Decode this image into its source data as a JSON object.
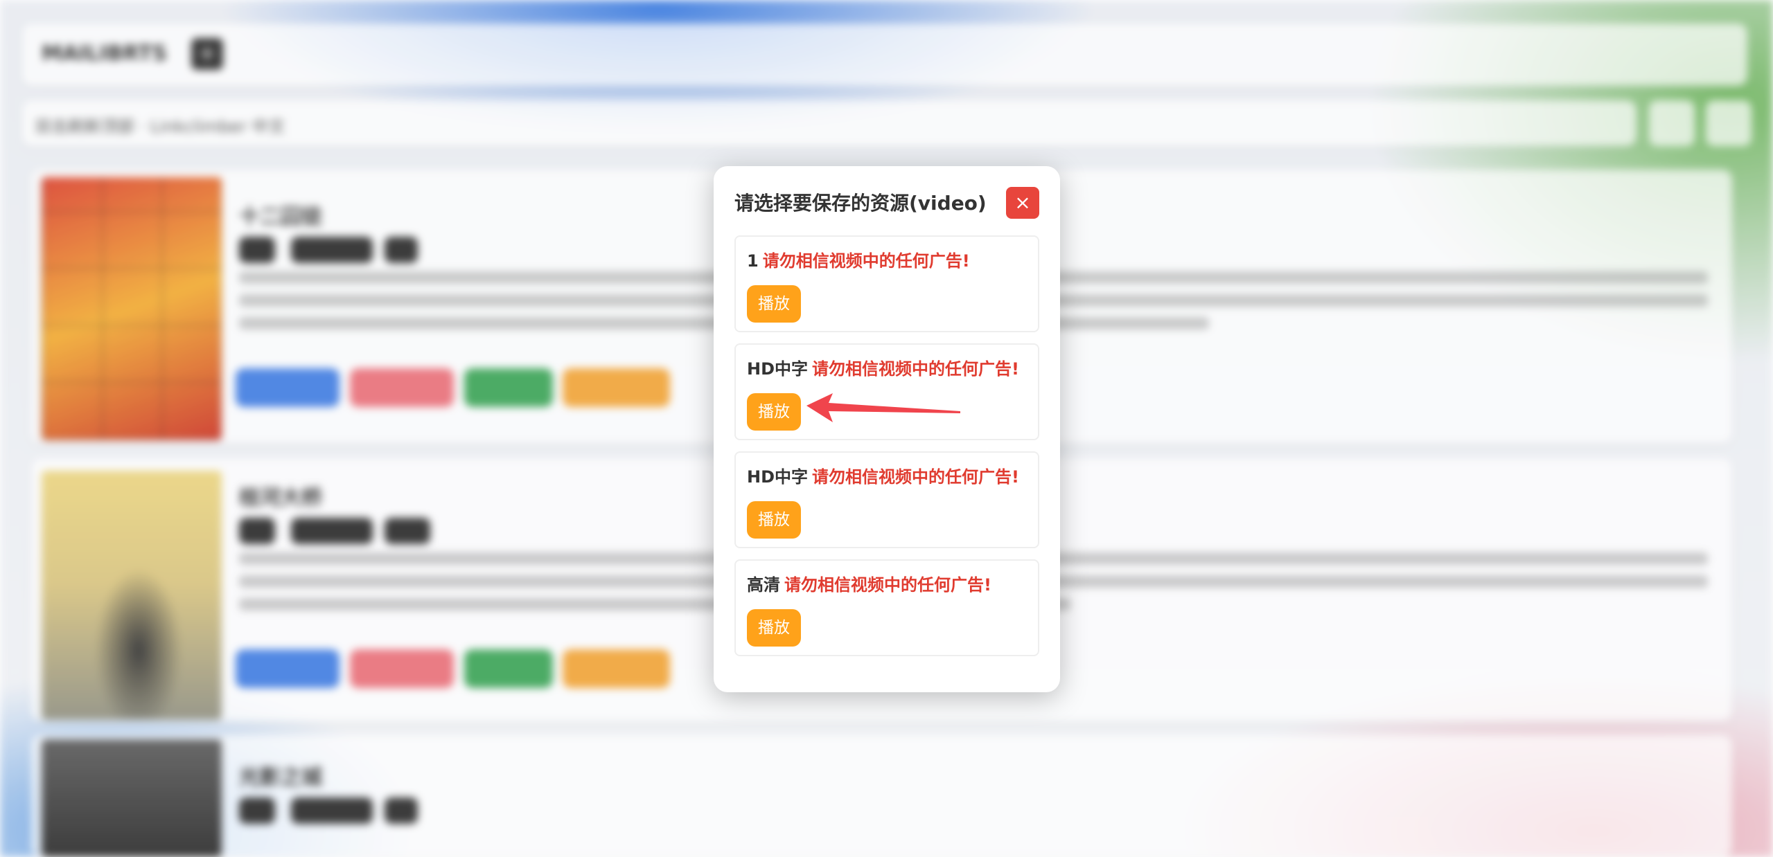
{
  "background": {
    "brand": "MAILIBRTS",
    "nav_text": "双击刷新顶部 · Linkclimber 中文",
    "movies": [
      {
        "title": "十二囚徒"
      },
      {
        "title": "桂河大桥"
      },
      {
        "title": "光影之城"
      }
    ]
  },
  "modal": {
    "title": "请选择要保存的资源(video)",
    "close_label": "×",
    "resources": [
      {
        "name": "1",
        "warning": "请勿相信视频中的任何广告!",
        "play_label": "播放"
      },
      {
        "name": "HD中字",
        "warning": "请勿相信视频中的任何广告!",
        "play_label": "播放"
      },
      {
        "name": "HD中字",
        "warning": "请勿相信视频中的任何广告!",
        "play_label": "播放"
      },
      {
        "name": "高清",
        "warning": "请勿相信视频中的任何广告!",
        "play_label": "播放"
      }
    ]
  },
  "colors": {
    "play_button": "#ffa21a",
    "close_button": "#e8453c",
    "warning_text": "#e03b2f",
    "annotation_arrow": "#f0444c"
  },
  "icons": {
    "close": "close-icon",
    "annotation": "arrow-annotation-icon"
  }
}
